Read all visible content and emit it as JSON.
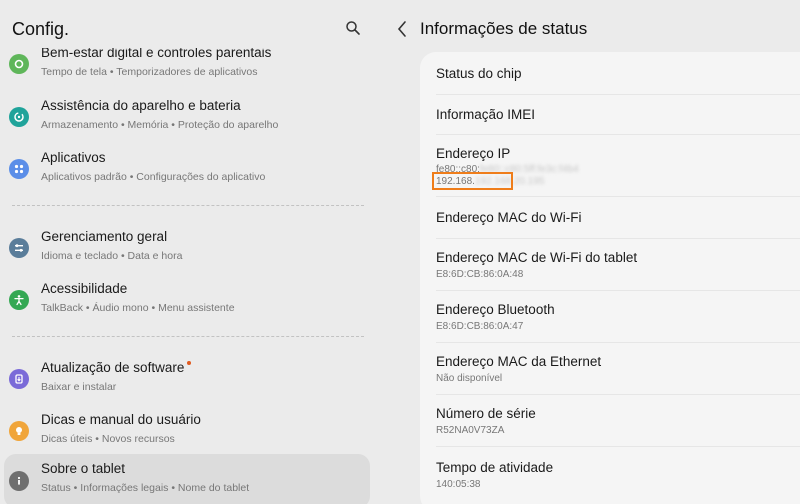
{
  "left_header": {
    "title": "Config."
  },
  "settings": [
    {
      "title": "Bem-estar digital e controles parentais",
      "subtitle": "Tempo de tela  •  Temporizadores de aplicativos",
      "icon": "leaf-icon",
      "color": "#5fb65a"
    },
    {
      "title": "Assistência do aparelho e bateria",
      "subtitle": "Armazenamento  •  Memória  •  Proteção do aparelho",
      "icon": "device-care-icon",
      "color": "#1fa39a"
    },
    {
      "title": "Aplicativos",
      "subtitle": "Aplicativos padrão  •  Configurações do aplicativo",
      "icon": "apps-grid-icon",
      "color": "#5b8ee8"
    },
    {
      "title": "Gerenciamento geral",
      "subtitle": "Idioma e teclado  •  Data e hora",
      "icon": "sliders-icon",
      "color": "#5a7d9a"
    },
    {
      "title": "Acessibilidade",
      "subtitle": "TalkBack  •  Áudio mono  •  Menu assistente",
      "icon": "accessibility-icon",
      "color": "#34a853"
    },
    {
      "title": "Atualização de software",
      "subtitle": "Baixar e instalar",
      "icon": "software-update-icon",
      "color": "#7a6ad8"
    },
    {
      "title": "Dicas e manual do usuário",
      "subtitle": "Dicas úteis  •  Novos recursos",
      "icon": "lightbulb-icon",
      "color": "#f0a53a"
    },
    {
      "title": "Sobre o tablet",
      "subtitle": "Status  •  Informações legais  •  Nome do tablet",
      "icon": "info-icon",
      "color": "#6f6f6f"
    }
  ],
  "right_header": {
    "title": "Informações de status"
  },
  "status": {
    "chip": {
      "title": "Status do chip"
    },
    "imei": {
      "title": "Informação IMEI"
    },
    "ip": {
      "title": "Endereço IP",
      "value1": "fe80::c80:5ff:fe3c:f4b4",
      "value2": "192.168.20.195"
    },
    "wifi_mac": {
      "title": "Endereço MAC do Wi-Fi"
    },
    "tablet_wifi_mac": {
      "title": "Endereço MAC de Wi-Fi do tablet",
      "value": "E8:6D:CB:86:0A:48"
    },
    "bluetooth": {
      "title": "Endereço Bluetooth",
      "value": "E8:6D:CB:86:0A:47"
    },
    "ethernet_mac": {
      "title": "Endereço MAC da Ethernet",
      "value": "Não disponível"
    },
    "serial": {
      "title": "Número de série",
      "value": "R52NA0V73ZA"
    },
    "uptime": {
      "title": "Tempo de atividade",
      "value": "140:05:38"
    }
  },
  "colors": {
    "highlight": "#ef7d1a",
    "update_dot": "#e05a1f"
  }
}
